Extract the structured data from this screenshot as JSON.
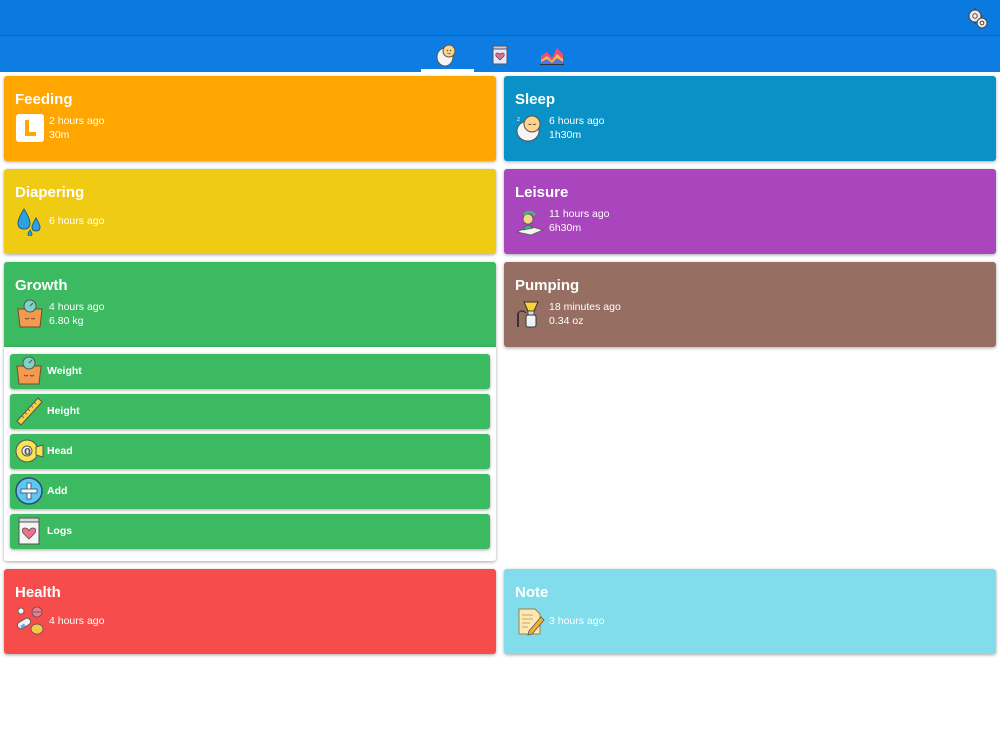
{
  "appbar": {
    "tabs": [
      {
        "icon": "baby-icon",
        "active": true
      },
      {
        "icon": "logs-heart-icon",
        "active": false
      },
      {
        "icon": "chart-icon",
        "active": false
      }
    ],
    "settings_icon": "gear-icon"
  },
  "cards": {
    "feeding": {
      "title": "Feeding",
      "line1": "2 hours ago",
      "line2": "30m",
      "icon": "breast-left-icon",
      "color": "#ffa600"
    },
    "sleep": {
      "title": "Sleep",
      "line1": "6 hours ago",
      "line2": "1h30m",
      "icon": "sleeping-baby-icon",
      "color": "#0a92c6"
    },
    "diapering": {
      "title": "Diapering",
      "line1": "6 hours ago",
      "icon": "droplets-icon",
      "color": "#f0cb14"
    },
    "leisure": {
      "title": "Leisure",
      "line1": "11 hours ago",
      "line2": "6h30m",
      "icon": "playmat-icon",
      "color": "#aa46bd"
    },
    "growth": {
      "title": "Growth",
      "line1": "4 hours ago",
      "line2": "6.80 kg",
      "icon": "scale-icon",
      "color": "#3cba62"
    },
    "pumping": {
      "title": "Pumping",
      "line1": "18 minutes ago",
      "line2": "0.34 oz",
      "icon": "breast-pump-icon",
      "color": "#966f62"
    },
    "health": {
      "title": "Health",
      "line1": "4 hours ago",
      "icon": "pills-icon",
      "color": "#f74c4c"
    },
    "note": {
      "title": "Note",
      "line1": "3 hours ago",
      "icon": "note-pencil-icon",
      "color": "#81dcec"
    }
  },
  "growth_menu": [
    {
      "label": "Weight",
      "icon": "scale-icon"
    },
    {
      "label": "Height",
      "icon": "ruler-icon"
    },
    {
      "label": "Head",
      "icon": "tape-measure-icon"
    },
    {
      "label": "Add",
      "icon": "add-circle-icon"
    },
    {
      "label": "Logs",
      "icon": "logs-heart-icon"
    }
  ]
}
